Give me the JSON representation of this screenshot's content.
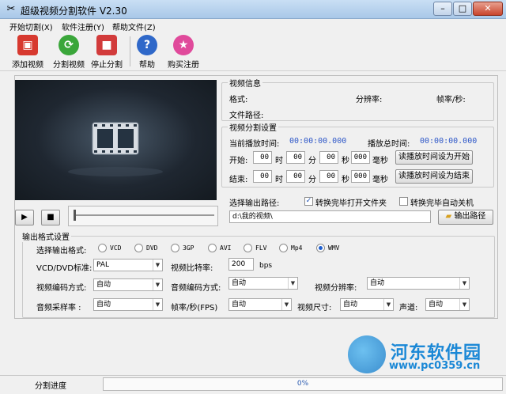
{
  "window": {
    "title": "超级视频分割软件 V2.30",
    "icon": "scissors-film-icon"
  },
  "menu": [
    "开始切割(X)",
    "软件注册(Y)",
    "帮助文件(Z)"
  ],
  "toolbar": [
    {
      "label": "添加视频",
      "icon": "add-video-icon",
      "color": "#d7392f"
    },
    {
      "label": "分割视频",
      "icon": "split-video-icon",
      "color": "#3aa63a"
    },
    {
      "label": "停止分割",
      "icon": "stop-split-icon",
      "color": "#d23b3b"
    },
    {
      "label": "帮助",
      "icon": "help-icon",
      "color": "#2f68c9"
    },
    {
      "label": "购买注册",
      "icon": "buy-register-icon",
      "color": "#e04a9b"
    }
  ],
  "video_info": {
    "title": "视频信息",
    "format_label": "格式:",
    "resolution_label": "分辨率:",
    "fps_label": "帧率/秒:",
    "path_label": "文件路径:"
  },
  "split": {
    "title": "视频分割设置",
    "current_label": "当前播放时间:",
    "current_value": "00:00:00.000",
    "total_label": "播放总时间:",
    "total_value": "00:00:00.000",
    "start_label": "开始:",
    "end_label": "结束:",
    "unit_h": "时",
    "unit_m": "分",
    "unit_s": "秒",
    "unit_ms": "毫秒",
    "start": {
      "h": "00",
      "m": "00",
      "s": "00",
      "ms": "000"
    },
    "end": {
      "h": "00",
      "m": "00",
      "s": "00",
      "ms": "000"
    },
    "set_start_btn": "读播放时间设为开始",
    "set_end_btn": "读播放时间设为结束"
  },
  "output": {
    "path_label": "选择输出路径:",
    "open_folder_label": "转换完毕打开文件夹",
    "open_folder_checked": true,
    "shutdown_label": "转换完毕自动关机",
    "shutdown_checked": false,
    "path_value": "d:\\我的视频\\",
    "browse_btn": "输出路径"
  },
  "format": {
    "title": "输出格式设置",
    "select_label": "选择输出格式:",
    "options": [
      "VCD",
      "DVD",
      "3GP",
      "AVI",
      "FLV",
      "Mp4",
      "WMV"
    ],
    "selected": "WMV",
    "vcd_label": "VCD/DVD标准:",
    "vcd_value": "PAL",
    "video_bitrate_label": "视频比特率:",
    "video_bitrate_value": "200",
    "bitrate_unit": "bps",
    "video_codec_label": "视频编码方式:",
    "video_codec_value": "自动",
    "audio_codec_label": "音频编码方式:",
    "audio_codec_value": "自动",
    "video_res_label": "视频分辨率:",
    "video_res_value": "自动",
    "audio_rate_label": "音频采样率  :",
    "audio_rate_value": "自动",
    "fps_label": "帧率/秒(FPS)",
    "fps_value": "自动",
    "video_size_label": "视频尺寸:",
    "video_size_value": "自动",
    "channel_label": "声道:",
    "channel_value": "自动"
  },
  "status": {
    "progress_label": "分割进度",
    "progress_text": "0%",
    "progress": 0
  },
  "watermark": {
    "text": "河东软件园",
    "url": "www.pc0359.cn"
  }
}
